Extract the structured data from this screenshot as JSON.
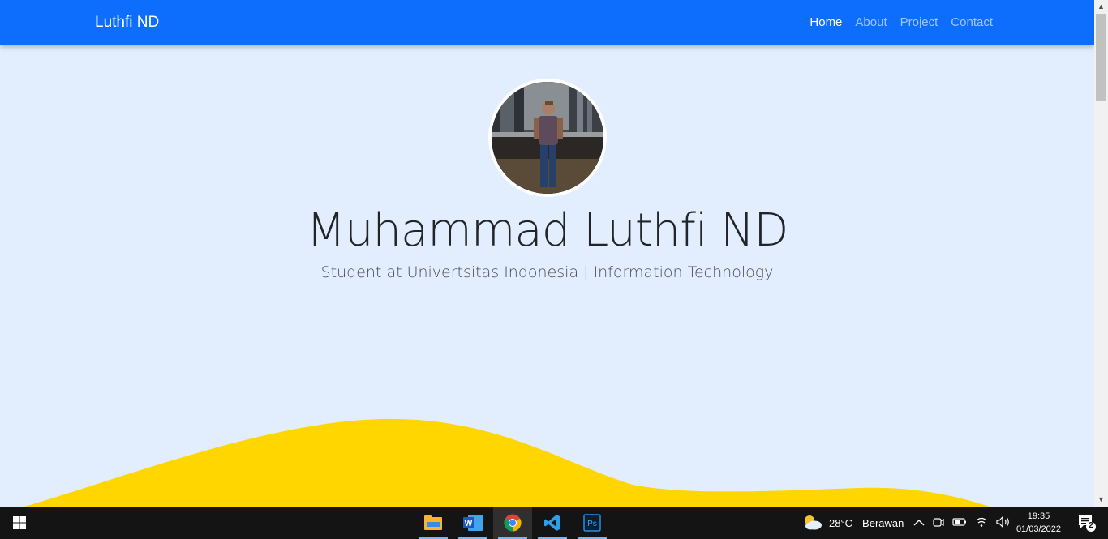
{
  "navbar": {
    "brand": "Luthfi ND",
    "links": [
      "Home",
      "About",
      "Project",
      "Contact"
    ],
    "active": "Home",
    "color": "#0d6efd"
  },
  "hero": {
    "name": "Muhammad Luthfi ND",
    "tagline": "Student at Univertsitas Indonesia | Information Technology",
    "background": "#e2edfd",
    "wave_color": "#ffd600"
  },
  "taskbar": {
    "apps": [
      "file-explorer-icon",
      "word-icon",
      "chrome-icon",
      "vscode-icon",
      "photoshop-icon"
    ],
    "weather_temp": "28°C",
    "weather_desc": "Berawan",
    "time": "19:35",
    "date": "01/03/2022",
    "notification_count": "2"
  }
}
